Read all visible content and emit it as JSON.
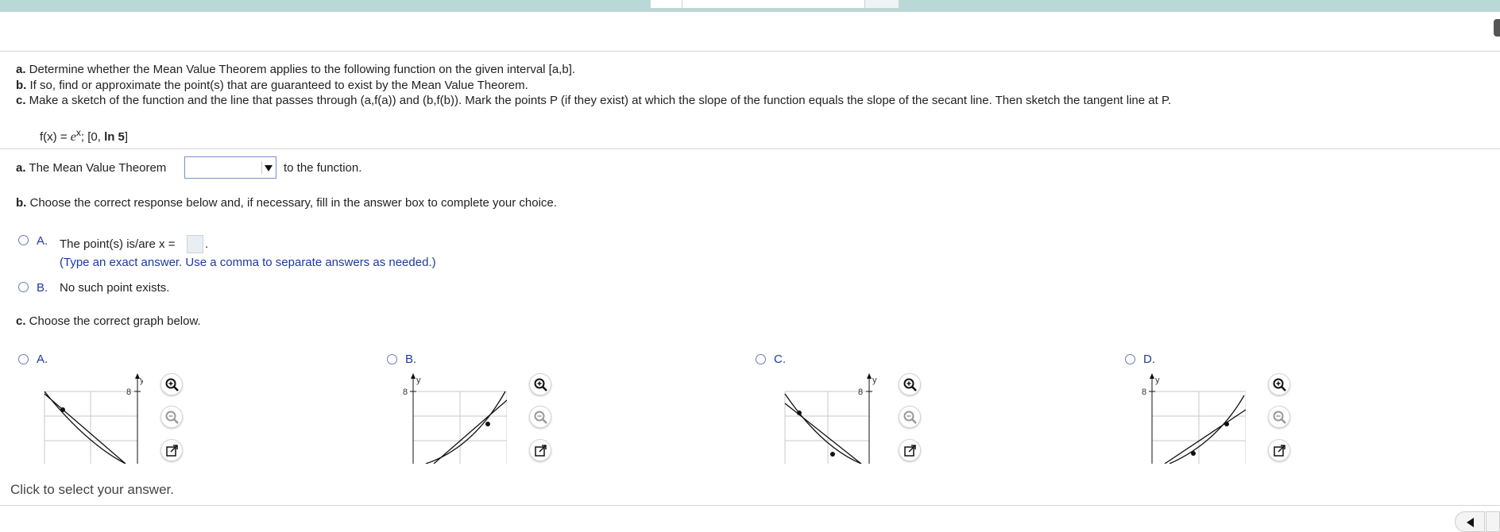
{
  "problem": {
    "part_a_label": "a.",
    "part_a_text": " Determine whether the Mean Value Theorem applies to the following function on the given interval [a,b].",
    "part_b_label": "b.",
    "part_b_text": " If so, find or approximate the point(s) that are guaranteed to exist by the Mean Value Theorem.",
    "part_c_label": "c.",
    "part_c_text": " Make a sketch of the function and the line that passes through (a,f(a)) and (b,f(b)). Mark the points P (if they exist) at which the slope of the function equals the slope of the secant line. Then sketch the tangent line at P.",
    "function_prefix": "f(x) = ",
    "function_base": "e",
    "function_exponent": "x",
    "function_sep": "; [0, ",
    "function_ln": "ln 5",
    "function_close": "]"
  },
  "question_a": {
    "label": "a.",
    "text": " The Mean Value Theorem",
    "dropdown_value": "",
    "suffix": "to the function."
  },
  "question_b": {
    "label": "b.",
    "text": " Choose the correct response below and, if necessary, fill in the answer box to complete your choice.",
    "option_a_label": "A.",
    "option_a_text": "The point(s) is/are x =",
    "option_a_value": "",
    "option_a_trail": ".",
    "option_a_hint": "(Type an exact answer. Use a comma to separate answers as needed.)",
    "option_b_label": "B.",
    "option_b_text": "No such point exists."
  },
  "question_c": {
    "label": "c.",
    "text": " Choose the correct graph below.",
    "options": [
      {
        "label": "A.",
        "tick": "8",
        "axis": "y"
      },
      {
        "label": "B.",
        "tick": "8",
        "axis": "y"
      },
      {
        "label": "C.",
        "tick": "8",
        "axis": "y"
      },
      {
        "label": "D.",
        "tick": "8",
        "axis": "y"
      }
    ]
  },
  "icons": {
    "zoom_in": "zoom-in-icon",
    "zoom_out": "zoom-out-icon",
    "popout": "popout-icon"
  },
  "footer": {
    "status": "Click to select your answer."
  },
  "colors": {
    "accent_blue": "#1d3aa4",
    "topbar": "#b9d9d6"
  }
}
